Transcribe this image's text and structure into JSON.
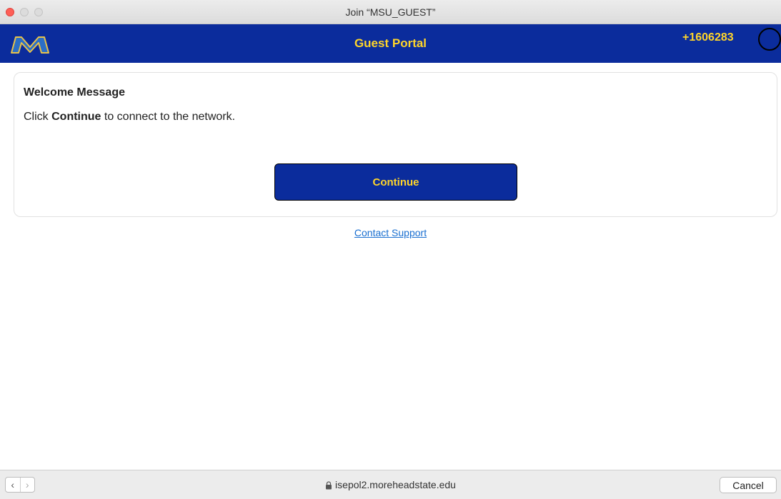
{
  "window": {
    "title": "Join “MSU_GUEST”"
  },
  "header": {
    "title": "Guest Portal",
    "phone": "+1606283",
    "logo_letter": "M",
    "colors": {
      "background": "#0b2c9c",
      "text": "#ffd52a"
    }
  },
  "card": {
    "title": "Welcome Message",
    "text_prefix": "Click ",
    "text_bold": "Continue",
    "text_suffix": " to connect to the network.",
    "continue_label": "Continue"
  },
  "support": {
    "link_label": "Contact Support"
  },
  "bottombar": {
    "back_icon": "‹",
    "forward_icon": "›",
    "url": "isepol2.moreheadstate.edu",
    "cancel_label": "Cancel"
  }
}
